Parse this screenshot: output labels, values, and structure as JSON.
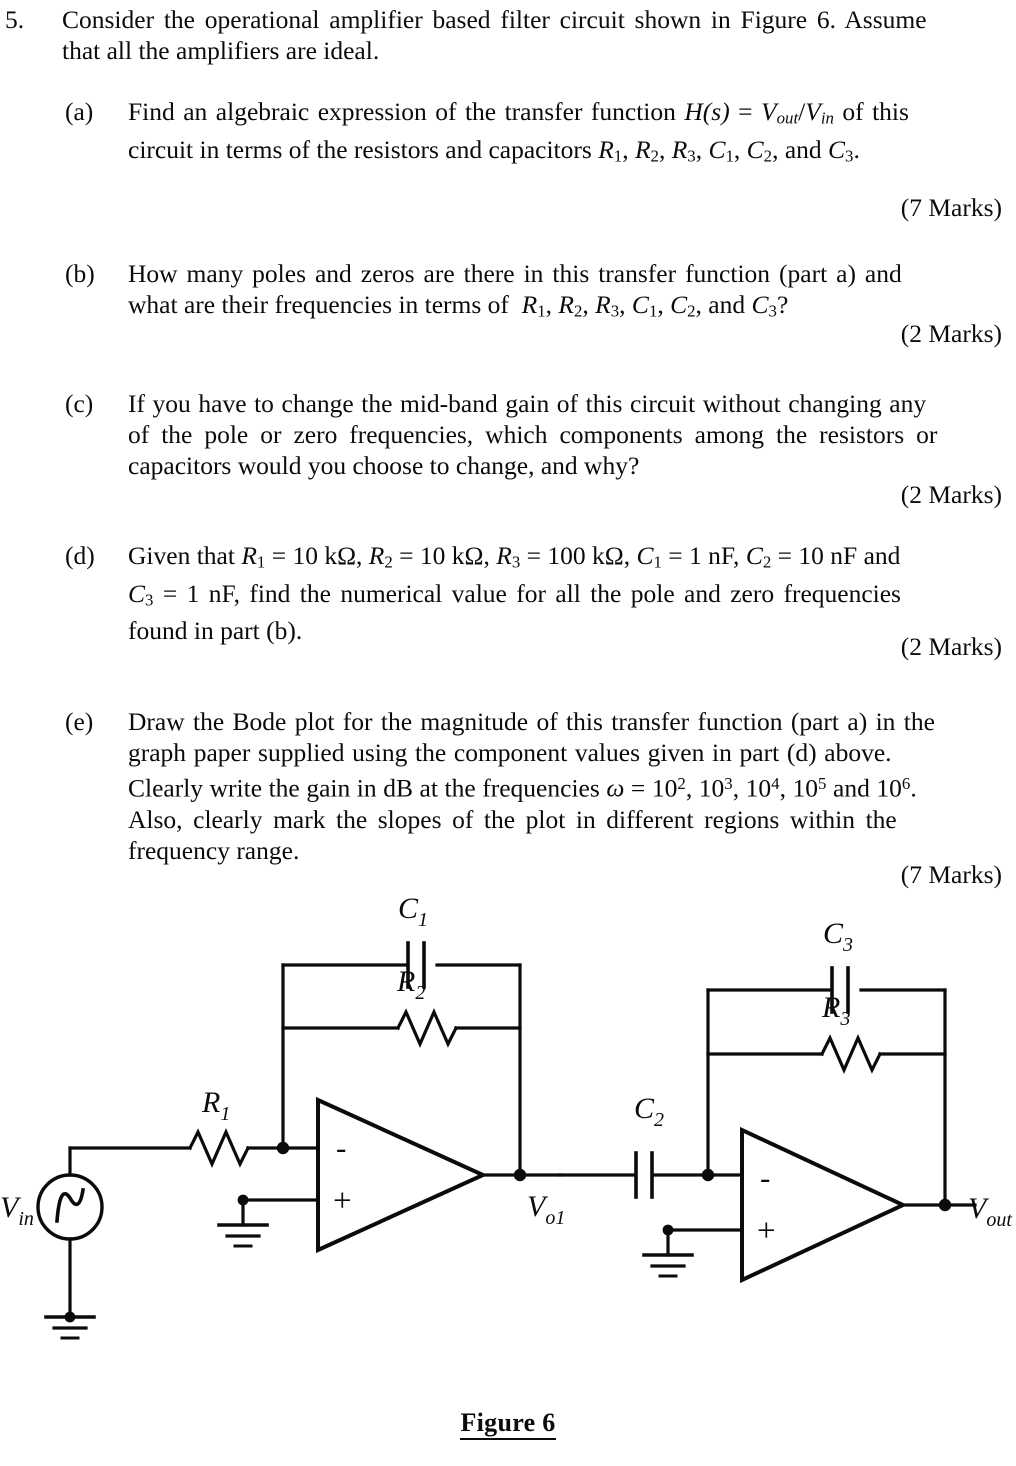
{
  "document": {
    "question_number": "5.",
    "stem": {
      "line1": "Consider the operational amplifier based filter circuit shown in Figure 6. Assume",
      "line2": "that all the amplifiers are ideal."
    },
    "parts": [
      {
        "label": "(a)",
        "lines": [
          "Find an algebraic expression of the transfer function H(s) = Vout/Vin of this",
          "circuit in terms of the resistors and capacitors R1, R2, R3, C1, C2, and C3."
        ],
        "marks": "(7 Marks)"
      },
      {
        "label": "(b)",
        "lines": [
          "How many poles and zeros are there in this transfer function (part a) and",
          "what are their frequencies in terms of  R1, R2, R3, C1, C2, and C3?"
        ],
        "marks": "(2 Marks)"
      },
      {
        "label": "(c)",
        "lines": [
          "If you have to change the mid-band gain of this circuit without changing any",
          "of the pole or zero frequencies, which components among the resistors or",
          "capacitors would you choose to change, and why?"
        ],
        "marks": "(2 Marks)"
      },
      {
        "label": "(d)",
        "lines": [
          "Given that R1 = 10 kΩ, R2 = 10 kΩ, R3 = 100 kΩ, C1 = 1 nF, C2 = 10 nF and",
          "C3 = 1 nF, find the numerical value for all the pole and zero frequencies",
          "found in part (b)."
        ],
        "marks": "(2 Marks)"
      },
      {
        "label": "(e)",
        "lines": [
          "Draw the Bode plot for the magnitude of this transfer function (part a) in the",
          "graph paper supplied using the component values given in part (d) above.",
          "Clearly write the gain in dB at the frequencies ω = 10^2, 10^3, 10^4, 10^5 and 10^6.",
          "Also, clearly mark the slopes of the plot in different regions within the",
          "frequency range."
        ],
        "marks": "(7 Marks)"
      }
    ],
    "figure": {
      "caption": "Figure 6",
      "labels": {
        "vin": "V",
        "vin_sub": "in",
        "r1": "R",
        "r1_sub": "1",
        "r2": "R",
        "r2_sub": "2",
        "c1": "C",
        "c1_sub": "1",
        "vo1": "V",
        "vo1_sub": "o1",
        "c2": "C",
        "c2_sub": "2",
        "r3": "R",
        "r3_sub": "3",
        "c3": "C",
        "c3_sub": "3",
        "vout": "V",
        "vout_sub": "out",
        "opamp_minus": "-",
        "opamp_plus": "+"
      }
    }
  },
  "style": {
    "ink": "#0b0b0b",
    "paper": "#ffffff"
  }
}
